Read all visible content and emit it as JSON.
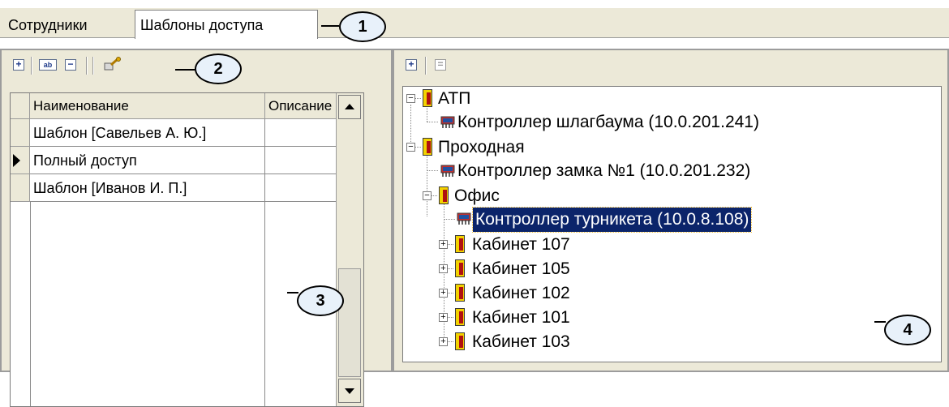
{
  "tabs": [
    {
      "label": "Сотрудники"
    },
    {
      "label": "Шаблоны доступа"
    }
  ],
  "callouts": [
    "1",
    "2",
    "3",
    "4"
  ],
  "left_toolbar": {
    "icons": [
      "add-icon",
      "rename-icon",
      "delete-icon",
      "access-key-icon"
    ]
  },
  "right_toolbar": {
    "icons": [
      "add-icon",
      "document-icon"
    ]
  },
  "grid": {
    "columns": [
      "Наименование",
      "Описание"
    ],
    "rows": [
      {
        "name": "Шаблон [Савельев А. Ю.]",
        "description": "",
        "current": false
      },
      {
        "name": "Полный доступ",
        "description": "",
        "current": true
      },
      {
        "name": "Шаблон [Иванов И. П.]",
        "description": "",
        "current": false
      }
    ]
  },
  "tree": {
    "nodes": [
      {
        "label": "АТП",
        "kind": "zone",
        "expander": "minus"
      },
      {
        "label": "Контроллер шлагбаума (10.0.201.241)",
        "kind": "controller"
      },
      {
        "label": "Проходная",
        "kind": "zone",
        "expander": "minus"
      },
      {
        "label": "Контроллер замка №1 (10.0.201.232)",
        "kind": "controller"
      },
      {
        "label": "Офис",
        "kind": "zone",
        "expander": "minus"
      },
      {
        "label": "Контроллер турникета (10.0.8.108)",
        "kind": "controller",
        "selected": true
      },
      {
        "label": "Кабинет 107",
        "kind": "zone",
        "expander": "plus"
      },
      {
        "label": "Кабинет 105",
        "kind": "zone",
        "expander": "plus"
      },
      {
        "label": "Кабинет 102",
        "kind": "zone",
        "expander": "plus"
      },
      {
        "label": "Кабинет 101",
        "kind": "zone",
        "expander": "plus"
      },
      {
        "label": "Кабинет 103",
        "kind": "zone",
        "expander": "plus"
      }
    ]
  },
  "colors": {
    "window_bg": "#ece9d8",
    "selection_bg": "#0b246a",
    "callout_bg": "#e8f1fa",
    "door_yellow": "#f3d200",
    "door_red": "#b01010"
  }
}
